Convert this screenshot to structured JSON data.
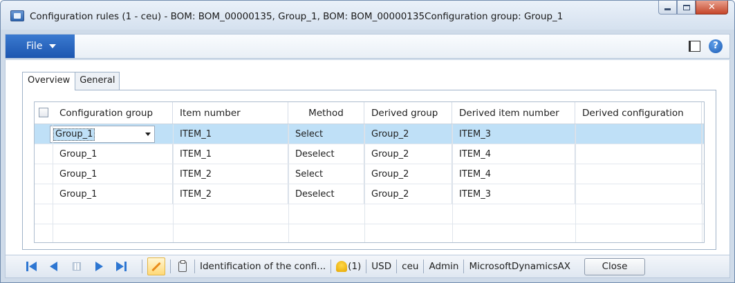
{
  "window": {
    "title": "Configuration rules (1 - ceu) - BOM: BOM_00000135, Group_1, BOM: BOM_00000135Configuration group: Group_1"
  },
  "ribbon": {
    "file_label": "File"
  },
  "tabs": [
    {
      "label": "Overview",
      "active": true
    },
    {
      "label": "General",
      "active": false
    }
  ],
  "grid": {
    "columns": [
      "Configuration group",
      "Item number",
      "Method",
      "Derived group",
      "Derived item number",
      "Derived configuration"
    ],
    "rows": [
      {
        "configuration_group": "Group_1",
        "item_number": "ITEM_1",
        "method": "Select",
        "derived_group": "Group_2",
        "derived_item_number": "ITEM_3",
        "derived_configuration": ""
      },
      {
        "configuration_group": "Group_1",
        "item_number": "ITEM_1",
        "method": "Deselect",
        "derived_group": "Group_2",
        "derived_item_number": "ITEM_4",
        "derived_configuration": ""
      },
      {
        "configuration_group": "Group_1",
        "item_number": "ITEM_2",
        "method": "Select",
        "derived_group": "Group_2",
        "derived_item_number": "ITEM_4",
        "derived_configuration": ""
      },
      {
        "configuration_group": "Group_1",
        "item_number": "ITEM_2",
        "method": "Deselect",
        "derived_group": "Group_2",
        "derived_item_number": "ITEM_3",
        "derived_configuration": ""
      }
    ],
    "selected_row": 0
  },
  "statusbar": {
    "identification": "Identification of the confi...",
    "notifications": "(1)",
    "currency": "USD",
    "company": "ceu",
    "user": "Admin",
    "system": "MicrosoftDynamicsAX",
    "close_label": "Close"
  },
  "colors": {
    "accent": "#1c56b0",
    "selection": "#bfe0f7",
    "nav_blue": "#2d76d2"
  }
}
